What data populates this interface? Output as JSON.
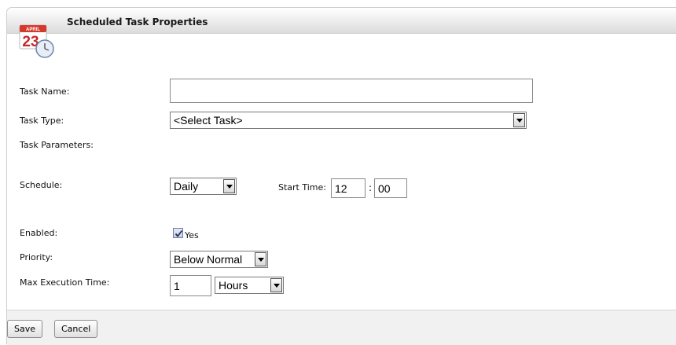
{
  "header": {
    "title": "Scheduled Task Properties"
  },
  "calendar": {
    "month": "APRIL",
    "day": "23"
  },
  "form": {
    "task_name": {
      "label": "Task Name:",
      "value": ""
    },
    "task_type": {
      "label": "Task Type:",
      "selected": "<Select Task>"
    },
    "task_parameters": {
      "label": "Task Parameters:"
    },
    "schedule": {
      "label": "Schedule:",
      "selected": "Daily",
      "start_time_label": "Start Time:",
      "hour": "12",
      "separator": ":",
      "minute": "00"
    },
    "enabled": {
      "label": "Enabled:",
      "checked": true,
      "option_label": "Yes"
    },
    "priority": {
      "label": "Priority:",
      "selected": "Below Normal"
    },
    "max_execution_time": {
      "label": "Max Execution Time:",
      "value": "1",
      "unit": "Hours"
    }
  },
  "footer": {
    "save_label": "Save",
    "cancel_label": "Cancel"
  },
  "colors": {
    "header_top": "#ffffff",
    "header_bottom": "#dcdcdc",
    "footer_bg": "#f1f1f1",
    "border": "#cfcfcf"
  },
  "icons": {
    "calendar": "calendar-clock-icon",
    "checkbox": "checkmark-icon",
    "dropdown": "chevron-down-icon"
  }
}
